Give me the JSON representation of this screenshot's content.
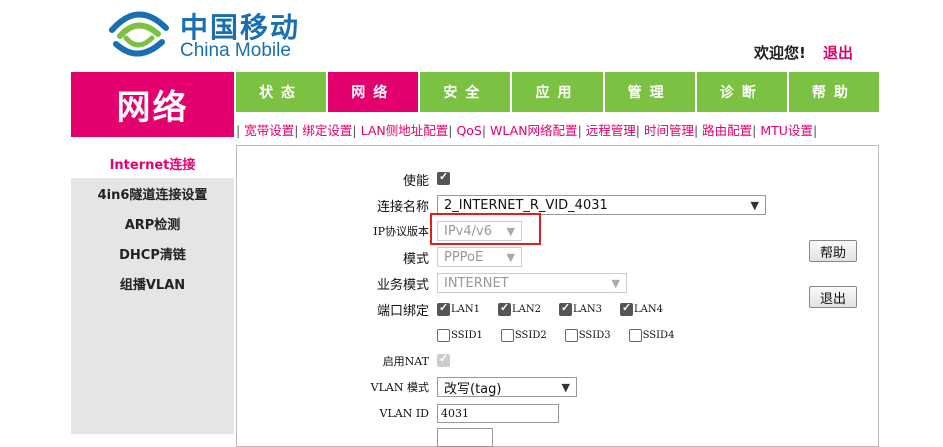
{
  "brand": {
    "name_cn": "中国移动",
    "name_en": "China Mobile"
  },
  "header": {
    "welcome": "欢迎您!",
    "logout": "退出"
  },
  "section_title": "网络",
  "tabs": [
    "状态",
    "网络",
    "安全",
    "应用",
    "管理",
    "诊断",
    "帮助"
  ],
  "active_tab": "网络",
  "submenu": [
    "宽带设置",
    "绑定设置",
    "LAN侧地址配置",
    "QoS",
    "WLAN网络配置",
    "远程管理",
    "时间管理",
    "路由配置",
    "MTU设置"
  ],
  "sidebar": {
    "items": [
      "Internet连接",
      "4in6隧道连接设置",
      "ARP检测",
      "DHCP清链",
      "组播VLAN"
    ],
    "active": "Internet连接"
  },
  "form": {
    "enable": {
      "label": "使能",
      "checked": true
    },
    "connection_name": {
      "label": "连接名称",
      "value": "2_INTERNET_R_VID_4031"
    },
    "ip_protocol": {
      "label": "IP协议版本",
      "value": "IPv4/v6"
    },
    "mode": {
      "label": "模式",
      "value": "PPPoE"
    },
    "service_mode": {
      "label": "业务模式",
      "value": "INTERNET"
    },
    "port_binding": {
      "label": "端口绑定",
      "lan": [
        "LAN1",
        "LAN2",
        "LAN3",
        "LAN4"
      ],
      "ssid": [
        "SSID1",
        "SSID2",
        "SSID3",
        "SSID4"
      ]
    },
    "nat": {
      "label": "启用NAT"
    },
    "vlan_mode": {
      "label": "VLAN 模式",
      "value": "改写(tag)"
    },
    "vlan_id": {
      "label": "VLAN ID",
      "value": "4031"
    }
  },
  "buttons": {
    "help": "帮助",
    "exit": "退出"
  },
  "colors": {
    "brand_pink": "#e4006f",
    "tab_green": "#7bc142",
    "logo_blue": "#1a6fb0",
    "highlight_red": "#e0201c"
  }
}
